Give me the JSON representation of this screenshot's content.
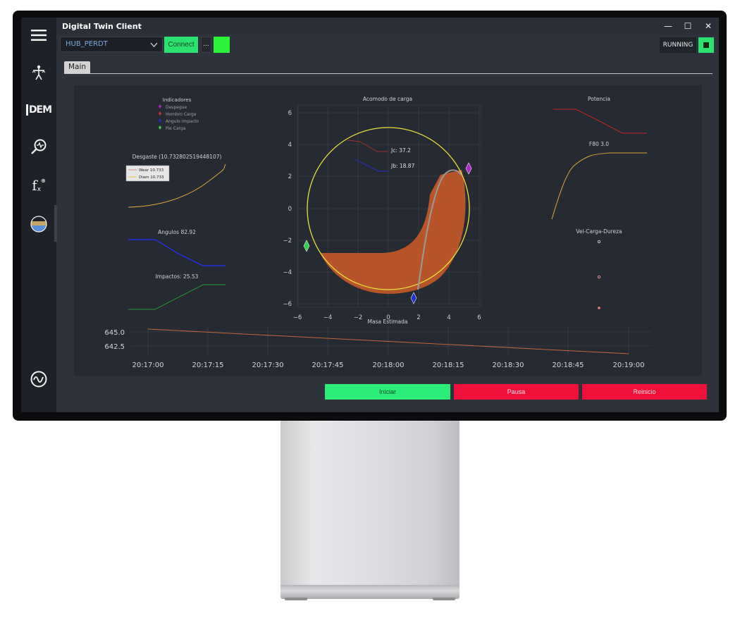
{
  "window": {
    "title": "Digital Twin Client"
  },
  "window_controls": {
    "minimize": "—",
    "maximize": "☐",
    "close": "✕"
  },
  "toolbar": {
    "hub_value": "HUB_PERDT",
    "connect_label": "Connect",
    "more_label": "...",
    "led_color": "#2af33a",
    "status_label": "RUNNING"
  },
  "sidebar": {
    "icons": [
      "menu-icon",
      "person-signal-icon",
      "dem-icon",
      "search-analysis-icon",
      "function-icon",
      "material-layers-icon",
      "signal-wave-icon"
    ],
    "dem_text": "DEM",
    "fx_text": "f",
    "fx_sub": "x"
  },
  "tabs": [
    {
      "label": "Main"
    }
  ],
  "charts": {
    "legend_indicadores": {
      "title": "Indicadores",
      "items": [
        {
          "label": "Despegue",
          "color": "#b025c8",
          "marker": "diamond"
        },
        {
          "label": "Hombro Carga",
          "color": "#e02f2f",
          "marker": "diamond"
        },
        {
          "label": "Angulo Impacto",
          "color": "#2233cc",
          "marker": "diamond"
        },
        {
          "label": "Pie Carga",
          "color": "#2fd04a",
          "marker": "diamond"
        }
      ]
    },
    "desgaste": {
      "title": "Desgaste (10.732802519448107)",
      "legend": [
        {
          "label": "Wear 10.733",
          "color": "#d48b8b"
        },
        {
          "label": "Diam 10.733",
          "color": "#e6c53a"
        }
      ],
      "line_color": "#d9a63a"
    },
    "angulos": {
      "title": "Angulos 82.92",
      "line_color": "#2233dd"
    },
    "impactos": {
      "title": "Impactos: 25.53",
      "line_color": "#1f9a3a"
    },
    "acomodo": {
      "title": "Acomodo de carga",
      "x_ticks": [
        "−6",
        "−4",
        "−2",
        "0",
        "2",
        "4",
        "6"
      ],
      "y_ticks": [
        "6",
        "4",
        "2",
        "0",
        "−2",
        "−4",
        "−6"
      ],
      "jc_label": "Jc: 37.2",
      "jb_label": "Jb: 18.87",
      "circle_color": "#e8e13a",
      "charge_color": "#b8542a"
    },
    "potencia": {
      "title": "Potencia",
      "line_color": "#c7262a"
    },
    "f80": {
      "title": "F80 3.0",
      "line_color": "#d9a63a"
    },
    "vel_carga": {
      "title": "Vel-Carga-Dureza",
      "points": [
        {
          "color": "#e0e0e0"
        },
        {
          "color": "#f0a0a0"
        },
        {
          "color": "#f08080"
        }
      ]
    },
    "masa": {
      "title": "Masa Estimada",
      "y_ticks": [
        "645.0",
        "642.5"
      ],
      "x_ticks": [
        "20:17:00",
        "20:17:15",
        "20:17:30",
        "20:17:45",
        "20:18:00",
        "20:18:15",
        "20:18:30",
        "20:18:45",
        "20:19:00"
      ],
      "line_color": "#c4673a"
    }
  },
  "buttons": {
    "start": "Iniciar",
    "pause": "Pausa",
    "reset": "Reinicio"
  }
}
